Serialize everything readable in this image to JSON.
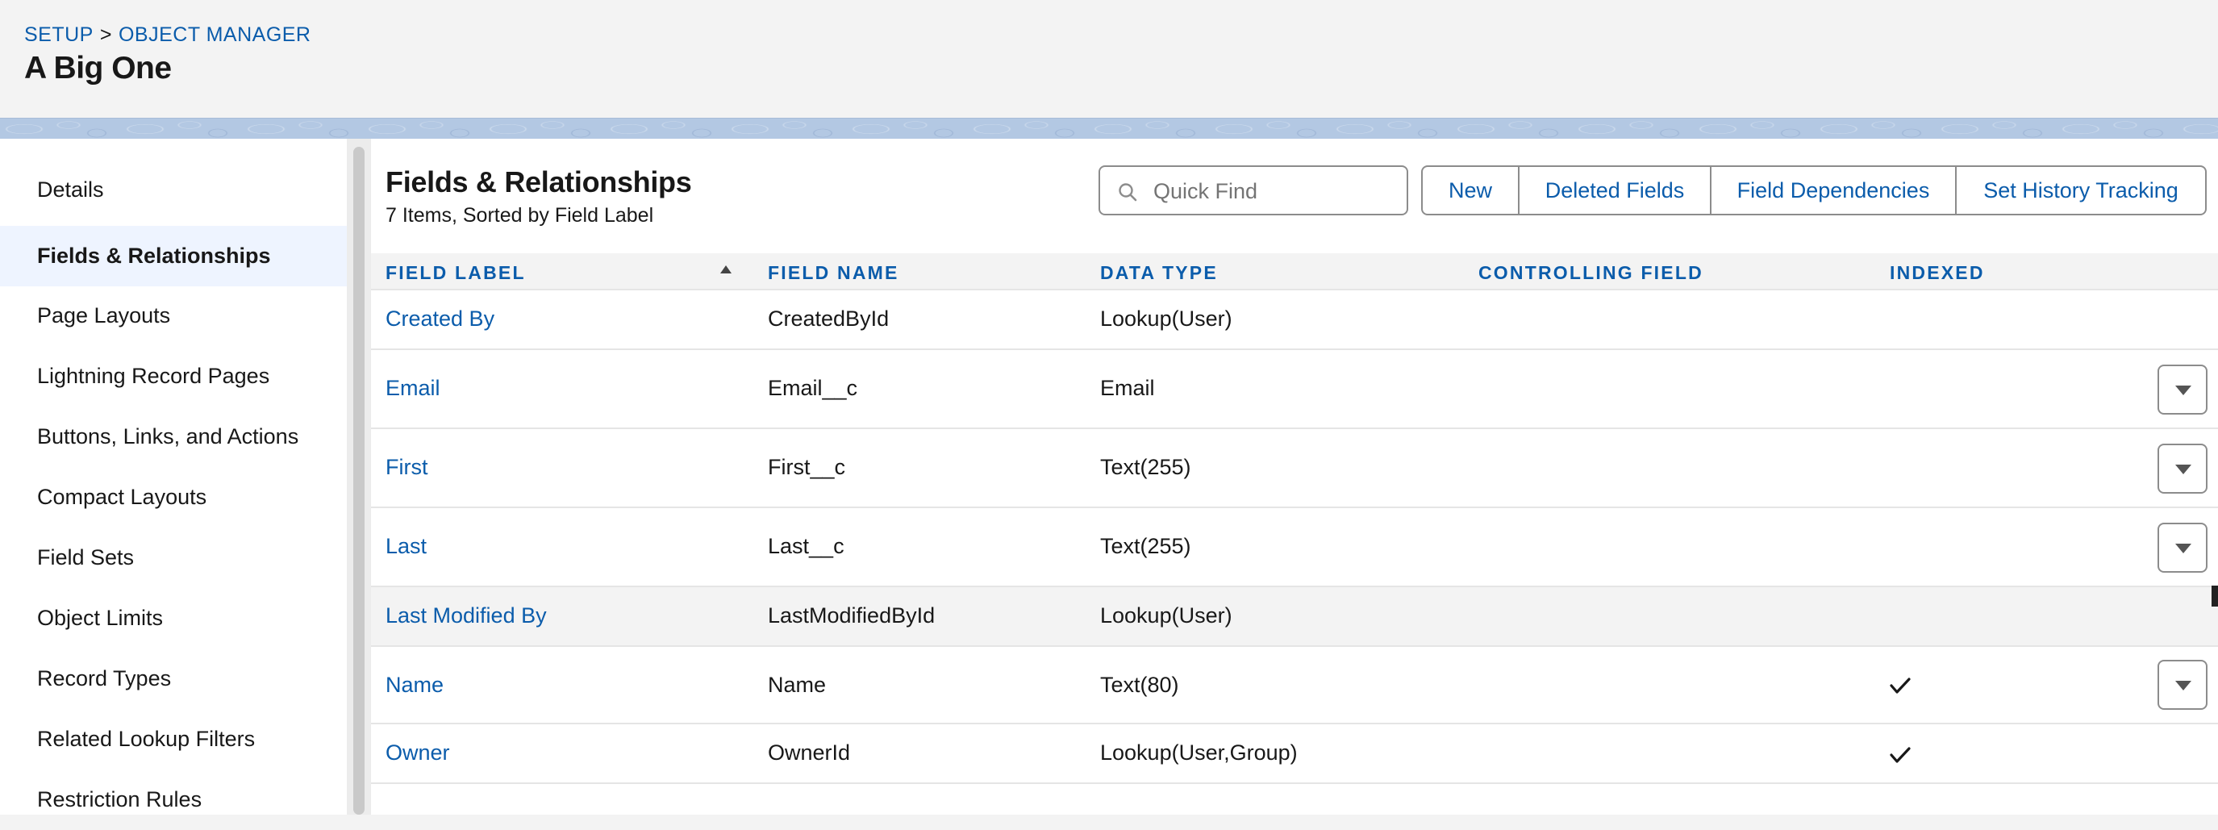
{
  "breadcrumb": {
    "setup": "SETUP",
    "separator": ">",
    "object_manager": "OBJECT MANAGER"
  },
  "page_title": "A Big One",
  "sidebar": {
    "items": [
      {
        "label": "Details"
      },
      {
        "label": "Fields & Relationships",
        "active": true
      },
      {
        "label": "Page Layouts"
      },
      {
        "label": "Lightning Record Pages"
      },
      {
        "label": "Buttons, Links, and Actions"
      },
      {
        "label": "Compact Layouts"
      },
      {
        "label": "Field Sets"
      },
      {
        "label": "Object Limits"
      },
      {
        "label": "Record Types"
      },
      {
        "label": "Related Lookup Filters"
      },
      {
        "label": "Restriction Rules"
      }
    ]
  },
  "section": {
    "title": "Fields & Relationships",
    "subtitle": "7 Items, Sorted by Field Label"
  },
  "search": {
    "placeholder": "Quick Find",
    "value": ""
  },
  "toolbar": {
    "new": "New",
    "deleted_fields": "Deleted Fields",
    "field_dependencies": "Field Dependencies",
    "set_history_tracking": "Set History Tracking"
  },
  "table": {
    "columns": [
      "FIELD LABEL",
      "FIELD NAME",
      "DATA TYPE",
      "CONTROLLING FIELD",
      "INDEXED"
    ],
    "sort": {
      "column": "FIELD LABEL",
      "direction": "ascending"
    },
    "rows": [
      {
        "label": "Created By",
        "name": "CreatedById",
        "type": "Lookup(User)",
        "controlling": "",
        "indexed": false,
        "has_menu": false
      },
      {
        "label": "Email",
        "name": "Email__c",
        "type": "Email",
        "controlling": "",
        "indexed": false,
        "has_menu": true
      },
      {
        "label": "First",
        "name": "First__c",
        "type": "Text(255)",
        "controlling": "",
        "indexed": false,
        "has_menu": true
      },
      {
        "label": "Last",
        "name": "Last__c",
        "type": "Text(255)",
        "controlling": "",
        "indexed": false,
        "has_menu": true
      },
      {
        "label": "Last Modified By",
        "name": "LastModifiedById",
        "type": "Lookup(User)",
        "controlling": "",
        "indexed": false,
        "has_menu": false
      },
      {
        "label": "Name",
        "name": "Name",
        "type": "Text(80)",
        "controlling": "",
        "indexed": true,
        "has_menu": true
      },
      {
        "label": "Owner",
        "name": "OwnerId",
        "type": "Lookup(User,Group)",
        "controlling": "",
        "indexed": true,
        "has_menu": false
      }
    ]
  },
  "colors": {
    "link": "#0b5cab",
    "active_nav_bg": "#eef4ff",
    "header_bg": "#f3f3f3"
  },
  "icons": {
    "search": "search-icon",
    "row_menu": "chevron-down-icon",
    "indexed": "checkmark-icon",
    "sort": "sort-ascending-icon"
  }
}
